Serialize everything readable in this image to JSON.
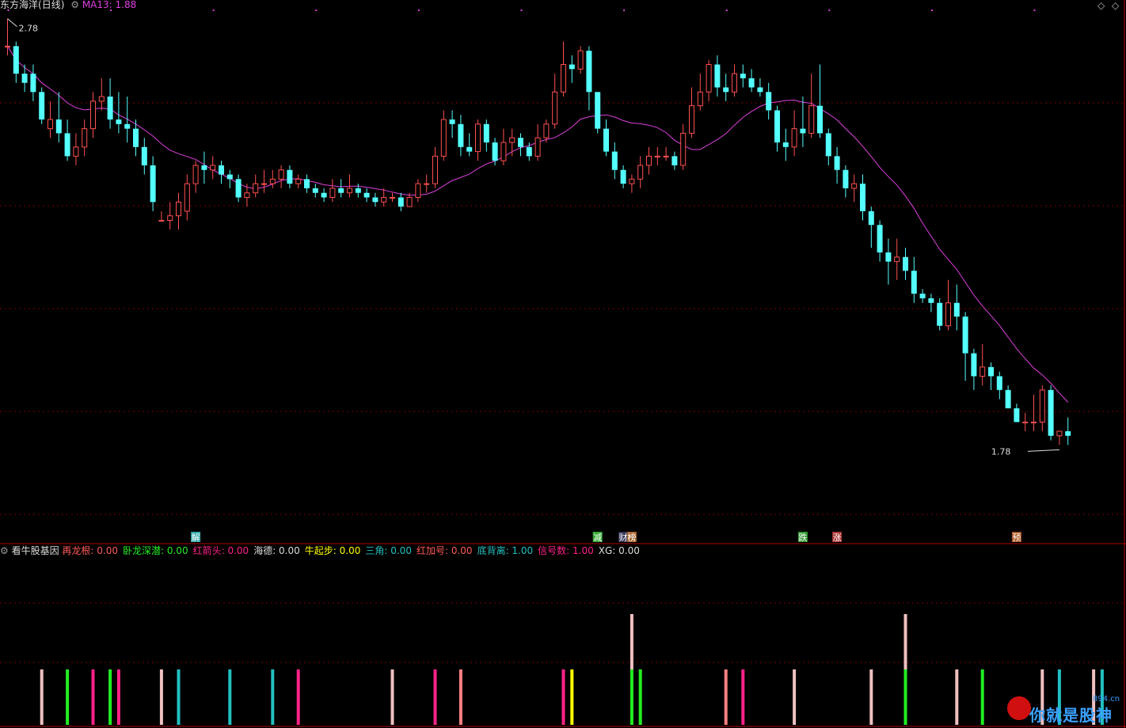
{
  "header": {
    "stock_name": "东方海洋",
    "period": "(日线)",
    "ma_label": "MA13:",
    "ma_value": "1.88",
    "high_label": "2.78",
    "low_label": "1.78"
  },
  "indicator": {
    "name": "看牛股基因",
    "items": [
      {
        "label": "再龙根:",
        "value": "0.00",
        "color": "#ff5a5a"
      },
      {
        "label": "卧龙深潜:",
        "value": "0.00",
        "color": "#22ee22"
      },
      {
        "label": "红箭头:",
        "value": "0.00",
        "color": "#ff2288"
      },
      {
        "label": "海德:",
        "value": "0.00",
        "color": "#dddddd"
      },
      {
        "label": "牛起步:",
        "value": "0.00",
        "color": "#ffff00"
      },
      {
        "label": "三角:",
        "value": "0.00",
        "color": "#22c0c0"
      },
      {
        "label": "红加号:",
        "value": "0.00",
        "color": "#ff5a5a"
      },
      {
        "label": "底背离:",
        "value": "1.00",
        "color": "#22c0c0"
      },
      {
        "label": "信号数:",
        "value": "1.00",
        "color": "#ff2288"
      },
      {
        "label": "XG:",
        "value": "0.00",
        "color": "#dddddd"
      }
    ]
  },
  "event_tags": [
    {
      "index": 22,
      "text": "解",
      "color": "#3aa"
    },
    {
      "index": 69,
      "text": "减",
      "color": "#3a3"
    },
    {
      "index": 72,
      "text": "财",
      "color": "#335"
    },
    {
      "index": 73,
      "text": "榜",
      "color": "#a63"
    },
    {
      "index": 93,
      "text": "跌",
      "color": "#393"
    },
    {
      "index": 97,
      "text": "涨",
      "color": "#a33"
    },
    {
      "index": 118,
      "text": "预",
      "color": "#a52"
    }
  ],
  "brand": {
    "text": "你就是股神",
    "domain": "894.cn"
  },
  "colors": {
    "up": "#ff5050",
    "down": "#54ffff",
    "ma": "#e040e0",
    "grid": "#7a0000",
    "frame": "#b00000"
  },
  "chart_data": [
    {
      "type": "candlestick",
      "title": "东方海洋 (日线)",
      "ylim": [
        1.66,
        2.82
      ],
      "ma_period": 13,
      "max_label": 2.78,
      "min_label": 1.78,
      "candles": [
        [
          2.74,
          2.74,
          2.8,
          2.72
        ],
        [
          2.74,
          2.68,
          2.75,
          2.66
        ],
        [
          2.68,
          2.66,
          2.7,
          2.64
        ],
        [
          2.68,
          2.64,
          2.7,
          2.62
        ],
        [
          2.64,
          2.58,
          2.65,
          2.57
        ],
        [
          2.56,
          2.58,
          2.62,
          2.54
        ],
        [
          2.58,
          2.55,
          2.64,
          2.53
        ],
        [
          2.55,
          2.5,
          2.58,
          2.49
        ],
        [
          2.5,
          2.52,
          2.55,
          2.48
        ],
        [
          2.52,
          2.56,
          2.58,
          2.5
        ],
        [
          2.56,
          2.62,
          2.64,
          2.54
        ],
        [
          2.62,
          2.63,
          2.67,
          2.6
        ],
        [
          2.63,
          2.58,
          2.67,
          2.56
        ],
        [
          2.58,
          2.57,
          2.64,
          2.55
        ],
        [
          2.57,
          2.56,
          2.63,
          2.53
        ],
        [
          2.56,
          2.52,
          2.58,
          2.5
        ],
        [
          2.52,
          2.48,
          2.54,
          2.46
        ],
        [
          2.48,
          2.4,
          2.5,
          2.38
        ],
        [
          2.36,
          2.36,
          2.38,
          2.36
        ],
        [
          2.36,
          2.37,
          2.4,
          2.34
        ],
        [
          2.37,
          2.4,
          2.42,
          2.34
        ],
        [
          2.38,
          2.44,
          2.46,
          2.36
        ],
        [
          2.44,
          2.48,
          2.49,
          2.42
        ],
        [
          2.48,
          2.47,
          2.51,
          2.44
        ],
        [
          2.47,
          2.48,
          2.5,
          2.45
        ],
        [
          2.48,
          2.46,
          2.49,
          2.44
        ],
        [
          2.46,
          2.45,
          2.47,
          2.43
        ],
        [
          2.45,
          2.41,
          2.46,
          2.4
        ],
        [
          2.41,
          2.42,
          2.44,
          2.39
        ],
        [
          2.42,
          2.44,
          2.46,
          2.41
        ],
        [
          2.44,
          2.44,
          2.47,
          2.42
        ],
        [
          2.44,
          2.45,
          2.47,
          2.43
        ],
        [
          2.45,
          2.47,
          2.48,
          2.43
        ],
        [
          2.47,
          2.44,
          2.48,
          2.43
        ],
        [
          2.44,
          2.45,
          2.46,
          2.43
        ],
        [
          2.45,
          2.43,
          2.46,
          2.42
        ],
        [
          2.43,
          2.42,
          2.44,
          2.41
        ],
        [
          2.42,
          2.41,
          2.43,
          2.4
        ],
        [
          2.41,
          2.43,
          2.45,
          2.4
        ],
        [
          2.43,
          2.42,
          2.45,
          2.41
        ],
        [
          2.42,
          2.43,
          2.46,
          2.41
        ],
        [
          2.43,
          2.42,
          2.44,
          2.41
        ],
        [
          2.42,
          2.41,
          2.43,
          2.4
        ],
        [
          2.41,
          2.4,
          2.42,
          2.39
        ],
        [
          2.4,
          2.41,
          2.43,
          2.39
        ],
        [
          2.41,
          2.41,
          2.42,
          2.4
        ],
        [
          2.41,
          2.39,
          2.42,
          2.38
        ],
        [
          2.39,
          2.41,
          2.42,
          2.39
        ],
        [
          2.41,
          2.44,
          2.45,
          2.4
        ],
        [
          2.44,
          2.44,
          2.46,
          2.42
        ],
        [
          2.44,
          2.5,
          2.52,
          2.43
        ],
        [
          2.5,
          2.58,
          2.6,
          2.49
        ],
        [
          2.58,
          2.57,
          2.6,
          2.54
        ],
        [
          2.57,
          2.52,
          2.59,
          2.5
        ],
        [
          2.52,
          2.51,
          2.55,
          2.5
        ],
        [
          2.51,
          2.57,
          2.58,
          2.49
        ],
        [
          2.57,
          2.53,
          2.58,
          2.51
        ],
        [
          2.53,
          2.49,
          2.54,
          2.48
        ],
        [
          2.49,
          2.53,
          2.56,
          2.48
        ],
        [
          2.53,
          2.54,
          2.56,
          2.5
        ],
        [
          2.54,
          2.52,
          2.55,
          2.5
        ],
        [
          2.52,
          2.5,
          2.53,
          2.49
        ],
        [
          2.5,
          2.54,
          2.57,
          2.49
        ],
        [
          2.54,
          2.57,
          2.58,
          2.53
        ],
        [
          2.57,
          2.64,
          2.68,
          2.56
        ],
        [
          2.64,
          2.7,
          2.75,
          2.63
        ],
        [
          2.7,
          2.69,
          2.72,
          2.66
        ],
        [
          2.69,
          2.73,
          2.74,
          2.68
        ],
        [
          2.73,
          2.64,
          2.74,
          2.6
        ],
        [
          2.64,
          2.56,
          2.6,
          2.55
        ],
        [
          2.56,
          2.51,
          2.58,
          2.5
        ],
        [
          2.51,
          2.47,
          2.53,
          2.45
        ],
        [
          2.47,
          2.44,
          2.48,
          2.43
        ],
        [
          2.44,
          2.45,
          2.46,
          2.42
        ],
        [
          2.45,
          2.48,
          2.5,
          2.43
        ],
        [
          2.48,
          2.5,
          2.52,
          2.46
        ],
        [
          2.5,
          2.5,
          2.52,
          2.48
        ],
        [
          2.5,
          2.5,
          2.52,
          2.49
        ],
        [
          2.5,
          2.48,
          2.51,
          2.47
        ],
        [
          2.48,
          2.55,
          2.57,
          2.47
        ],
        [
          2.55,
          2.61,
          2.65,
          2.54
        ],
        [
          2.61,
          2.64,
          2.68,
          2.6
        ],
        [
          2.64,
          2.7,
          2.71,
          2.62
        ],
        [
          2.7,
          2.65,
          2.72,
          2.63
        ],
        [
          2.65,
          2.64,
          2.68,
          2.62
        ],
        [
          2.64,
          2.68,
          2.7,
          2.63
        ],
        [
          2.68,
          2.67,
          2.7,
          2.65
        ],
        [
          2.67,
          2.65,
          2.69,
          2.64
        ],
        [
          2.65,
          2.64,
          2.67,
          2.63
        ],
        [
          2.64,
          2.6,
          2.66,
          2.58
        ],
        [
          2.6,
          2.53,
          2.61,
          2.51
        ],
        [
          2.53,
          2.52,
          2.56,
          2.49
        ],
        [
          2.52,
          2.56,
          2.6,
          2.5
        ],
        [
          2.56,
          2.55,
          2.63,
          2.52
        ],
        [
          2.55,
          2.61,
          2.68,
          2.54
        ],
        [
          2.61,
          2.55,
          2.7,
          2.54
        ],
        [
          2.55,
          2.5,
          2.56,
          2.48
        ],
        [
          2.5,
          2.47,
          2.52,
          2.44
        ],
        [
          2.47,
          2.43,
          2.48,
          2.41
        ],
        [
          2.43,
          2.44,
          2.46,
          2.4
        ],
        [
          2.44,
          2.38,
          2.46,
          2.36
        ],
        [
          2.38,
          2.35,
          2.39,
          2.3
        ],
        [
          2.35,
          2.29,
          2.36,
          2.27
        ],
        [
          2.29,
          2.27,
          2.32,
          2.22
        ],
        [
          2.27,
          2.28,
          2.32,
          2.23
        ],
        [
          2.28,
          2.25,
          2.3,
          2.23
        ],
        [
          2.25,
          2.2,
          2.28,
          2.18
        ],
        [
          2.2,
          2.19,
          2.21,
          2.18
        ],
        [
          2.19,
          2.18,
          2.2,
          2.16
        ],
        [
          2.18,
          2.13,
          2.19,
          2.12
        ],
        [
          2.13,
          2.18,
          2.23,
          2.12
        ],
        [
          2.18,
          2.15,
          2.22,
          2.12
        ],
        [
          2.15,
          2.07,
          2.16,
          2.01
        ],
        [
          2.07,
          2.02,
          2.08,
          1.99
        ],
        [
          2.02,
          2.04,
          2.09,
          2.0
        ],
        [
          2.04,
          2.02,
          2.05,
          1.99
        ],
        [
          2.02,
          1.99,
          2.03,
          1.97
        ],
        [
          1.99,
          1.95,
          2.0,
          1.95
        ],
        [
          1.95,
          1.92,
          1.96,
          1.92
        ],
        [
          1.92,
          1.92,
          1.94,
          1.9
        ],
        [
          1.92,
          1.92,
          1.98,
          1.9
        ],
        [
          1.92,
          1.99,
          2.0,
          1.9
        ],
        [
          1.99,
          1.89,
          2.0,
          1.88
        ],
        [
          1.89,
          1.9,
          1.9,
          1.87
        ],
        [
          1.9,
          1.89,
          1.93,
          1.87
        ]
      ]
    },
    {
      "type": "bar",
      "title": "看牛股基因",
      "ylim": [
        0,
        5
      ],
      "note": "signal bars: index, stacked segment heights and colors",
      "signals": [
        {
          "i": 4,
          "segs": [
            [
              1,
              "#f0c0c0"
            ]
          ]
        },
        {
          "i": 7,
          "segs": [
            [
              1,
              "#22ee22"
            ]
          ]
        },
        {
          "i": 10,
          "segs": [
            [
              1,
              "#ff2288"
            ]
          ]
        },
        {
          "i": 12,
          "segs": [
            [
              1,
              "#22ee22"
            ]
          ]
        },
        {
          "i": 13,
          "segs": [
            [
              1,
              "#ff2288"
            ]
          ]
        },
        {
          "i": 18,
          "segs": [
            [
              1,
              "#f0c0c0"
            ]
          ]
        },
        {
          "i": 20,
          "segs": [
            [
              1,
              "#22c0c0"
            ]
          ]
        },
        {
          "i": 26,
          "segs": [
            [
              1,
              "#22c0c0"
            ]
          ]
        },
        {
          "i": 31,
          "segs": [
            [
              1,
              "#22c0c0"
            ]
          ]
        },
        {
          "i": 34,
          "segs": [
            [
              1,
              "#ff2288"
            ]
          ]
        },
        {
          "i": 45,
          "segs": [
            [
              1,
              "#f0c0c0"
            ]
          ]
        },
        {
          "i": 50,
          "segs": [
            [
              1,
              "#ff2288"
            ]
          ]
        },
        {
          "i": 53,
          "segs": [
            [
              1,
              "#ff8080"
            ]
          ]
        },
        {
          "i": 65,
          "segs": [
            [
              1,
              "#ff2288"
            ]
          ]
        },
        {
          "i": 66,
          "segs": [
            [
              1,
              "#ffff00"
            ]
          ]
        },
        {
          "i": 73,
          "segs": [
            [
              1,
              "#22ee22"
            ],
            [
              1,
              "#f0c0c0"
            ]
          ]
        },
        {
          "i": 74,
          "segs": [
            [
              1,
              "#22ee22"
            ]
          ]
        },
        {
          "i": 84,
          "segs": [
            [
              1,
              "#ff8080"
            ]
          ]
        },
        {
          "i": 86,
          "segs": [
            [
              1,
              "#ff2288"
            ]
          ]
        },
        {
          "i": 92,
          "segs": [
            [
              1,
              "#f0c0c0"
            ]
          ]
        },
        {
          "i": 101,
          "segs": [
            [
              1,
              "#f0c0c0"
            ]
          ]
        },
        {
          "i": 105,
          "segs": [
            [
              1,
              "#22ee22"
            ],
            [
              1,
              "#f0c0c0"
            ]
          ]
        },
        {
          "i": 111,
          "segs": [
            [
              1,
              "#f0c0c0"
            ]
          ]
        },
        {
          "i": 114,
          "segs": [
            [
              1,
              "#22ee22"
            ]
          ]
        },
        {
          "i": 121,
          "segs": [
            [
              1,
              "#f0c0c0"
            ]
          ]
        },
        {
          "i": 123,
          "segs": [
            [
              1,
              "#22c0c0"
            ]
          ]
        },
        {
          "i": 127,
          "segs": [
            [
              1,
              "#f0c0c0"
            ]
          ]
        },
        {
          "i": 128,
          "segs": [
            [
              1,
              "#22c0c0"
            ]
          ]
        }
      ]
    }
  ]
}
